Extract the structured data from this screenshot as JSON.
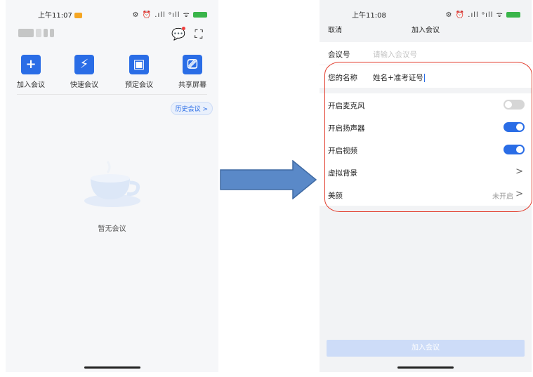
{
  "left": {
    "status_time": "上午11:07",
    "status_icons": "⚙ ⏰ .ıll ᵊıll ᯤ",
    "actions": [
      {
        "label": "加入会议",
        "icon": "plus-icon"
      },
      {
        "label": "快速会议",
        "icon": "lightning-icon"
      },
      {
        "label": "预定会议",
        "icon": "calendar-icon"
      },
      {
        "label": "共享屏幕",
        "icon": "share-screen-icon"
      }
    ],
    "history_button": "历史会议 >",
    "empty_text": "暂无会议"
  },
  "right": {
    "status_time": "上午11:08",
    "status_icons": "⚙ ⏰ .ıll ᵊıll ᯤ",
    "nav": {
      "cancel": "取消",
      "title": "加入会议"
    },
    "meeting_id": {
      "label": "会议号",
      "placeholder": "请输入会议号"
    },
    "your_name": {
      "label": "您的名称",
      "value": "姓名+准考证号"
    },
    "settings": [
      {
        "label": "开启麦克风",
        "state": "off"
      },
      {
        "label": "开启扬声器",
        "state": "on"
      },
      {
        "label": "开启视频",
        "state": "on"
      }
    ],
    "virtual_bg": {
      "label": "虚拟背景",
      "chevron": ">"
    },
    "beauty": {
      "label": "美颜",
      "hint": "未开启",
      "chevron": ">"
    },
    "join_button": "加入会议"
  },
  "colors": {
    "accent": "#2a6de6",
    "arrow": "#5a89c8",
    "highlight": "#e23a2a"
  }
}
